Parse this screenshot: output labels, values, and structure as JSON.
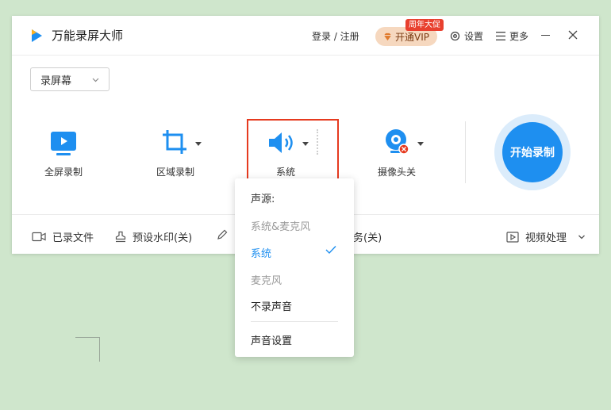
{
  "app": {
    "title": "万能录屏大师"
  },
  "header": {
    "login_label": "登录 / 注册",
    "vip_label": "开通VIP",
    "promo_badge": "周年大促",
    "settings_label": "设置",
    "more_label": "更多"
  },
  "mode_select": {
    "value": "录屏幕"
  },
  "tools": {
    "fullscreen_label": "全屏录制",
    "region_label": "区域录制",
    "audio_label": "系统",
    "camera_label": "摄像头关"
  },
  "start_button": {
    "label": "开始录制"
  },
  "bottom_bar": {
    "recorded_files_label": "已录文件",
    "watermark_label": "预设水印(关)",
    "task_label": "务(关)",
    "video_process_label": "视频处理"
  },
  "audio_dropdown": {
    "header": "声源:",
    "items": [
      {
        "label": "系统&麦克风",
        "state": "disabled"
      },
      {
        "label": "系统",
        "state": "selected"
      },
      {
        "label": "麦克风",
        "state": "disabled"
      },
      {
        "label": "不录声音",
        "state": "normal"
      }
    ],
    "settings_label": "声音设置"
  },
  "colors": {
    "accent": "#1e8ff0",
    "highlight_box": "#e63a1f",
    "background": "#cfe6cc",
    "vip_bg": "#f6d8bf",
    "promo_bg": "#e8402f"
  },
  "icons": [
    "app-logo-icon",
    "vip-diamond-icon",
    "settings-gear-icon",
    "more-menu-icon",
    "minimize-icon",
    "close-icon",
    "chevron-down-icon",
    "fullscreen-record-icon",
    "region-crop-icon",
    "speaker-icon",
    "camera-icon",
    "camera-off-badge-icon",
    "recorded-files-icon",
    "watermark-icon",
    "edit-pencil-icon",
    "video-process-icon",
    "checkmark-icon"
  ]
}
